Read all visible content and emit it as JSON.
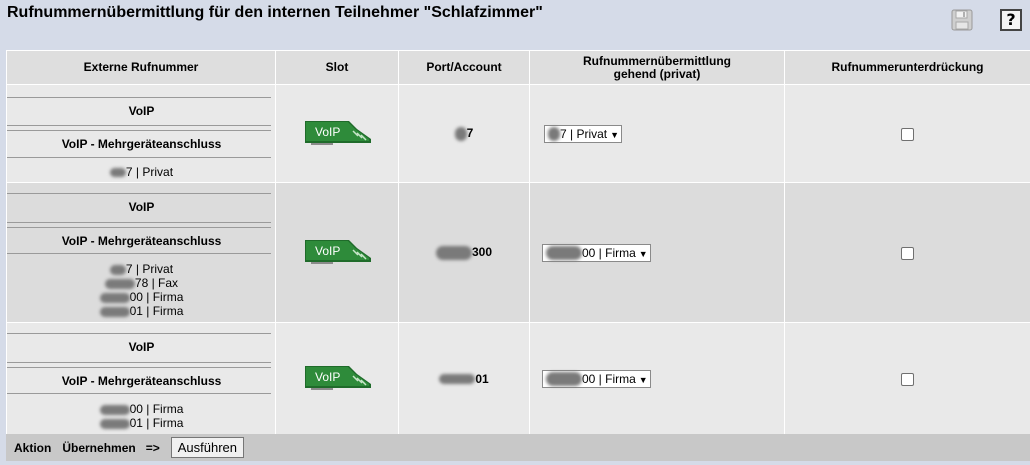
{
  "header": {
    "title": "Rufnummernübermittlung für den internen Teilnehmer \"Schlafzimmer\"",
    "save_icon": "save-icon",
    "help_icon_label": "?"
  },
  "table": {
    "columns": [
      "Externe Rufnummer",
      "Slot",
      "Port/Account",
      "Rufnummernübermittlung",
      "gehend (privat)",
      "Rufnummerunterdrückung"
    ],
    "rows": [
      {
        "ext_label1": "VoIP",
        "ext_label2": "VoIP - Mehrgeräteanschluss",
        "ext_lines": [
          "7 | Privat"
        ],
        "slot": "VoIP",
        "port": "7",
        "select_value": "7 | Privat",
        "suppress_checked": false
      },
      {
        "ext_label1": "VoIP",
        "ext_label2": "VoIP - Mehrgeräteanschluss",
        "ext_lines": [
          "7 | Privat",
          "78 | Fax",
          "00 | Firma",
          "01 | Firma"
        ],
        "slot": "VoIP",
        "port": "300",
        "select_value": "00 | Firma",
        "suppress_checked": false
      },
      {
        "ext_label1": "VoIP",
        "ext_label2": "VoIP - Mehrgeräteanschluss",
        "ext_lines": [
          "00 | Firma",
          "01 | Firma"
        ],
        "slot": "VoIP",
        "port": "01",
        "select_value": "00 | Firma",
        "suppress_checked": false
      }
    ]
  },
  "footer": {
    "aktion": "Aktion",
    "action_value": "Übernehmen",
    "arrow": "=>",
    "button": "Ausführen"
  },
  "colors": {
    "page_bg": "#d5dbe8",
    "header_bg": "#dedede",
    "voip_green": "#2e7d32"
  }
}
